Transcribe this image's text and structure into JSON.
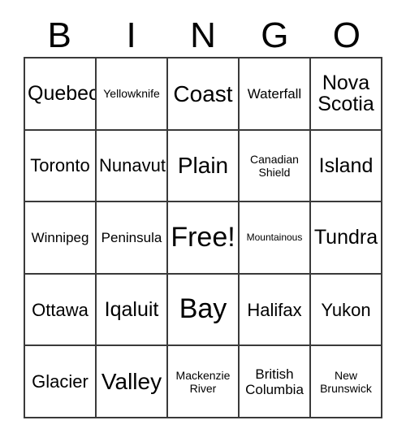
{
  "card": {
    "title": "BINGO",
    "header_letters": [
      "B",
      "I",
      "N",
      "G",
      "O"
    ],
    "free_space_label": "Free!",
    "colors": {
      "background": "#ffffff",
      "border": "#3a3a3a",
      "text": "#000000"
    },
    "rows": [
      [
        {
          "text": "Quebec",
          "size": "lg"
        },
        {
          "text": "Yellowknife",
          "size": "xs"
        },
        {
          "text": "Coast",
          "size": "xl"
        },
        {
          "text": "Waterfall",
          "size": "sm"
        },
        {
          "text": "Nova\nScotia",
          "size": "lg"
        }
      ],
      [
        {
          "text": "Toronto",
          "size": "md"
        },
        {
          "text": "Nunavut",
          "size": "md"
        },
        {
          "text": "Plain",
          "size": "xl"
        },
        {
          "text": "Canadian\nShield",
          "size": "xs"
        },
        {
          "text": "Island",
          "size": "lg"
        }
      ],
      [
        {
          "text": "Winnipeg",
          "size": "sm"
        },
        {
          "text": "Peninsula",
          "size": "sm"
        },
        {
          "text": "Free!",
          "size": "xxl"
        },
        {
          "text": "Mountainous",
          "size": "xxs"
        },
        {
          "text": "Tundra",
          "size": "lg"
        }
      ],
      [
        {
          "text": "Ottawa",
          "size": "md"
        },
        {
          "text": "Iqaluit",
          "size": "lg"
        },
        {
          "text": "Bay",
          "size": "xxl"
        },
        {
          "text": "Halifax",
          "size": "md"
        },
        {
          "text": "Yukon",
          "size": "md"
        }
      ],
      [
        {
          "text": "Glacier",
          "size": "md"
        },
        {
          "text": "Valley",
          "size": "xl"
        },
        {
          "text": "Mackenzie\nRiver",
          "size": "xs"
        },
        {
          "text": "British\nColumbia",
          "size": "sm"
        },
        {
          "text": "New\nBrunswick",
          "size": "xs"
        }
      ]
    ]
  }
}
